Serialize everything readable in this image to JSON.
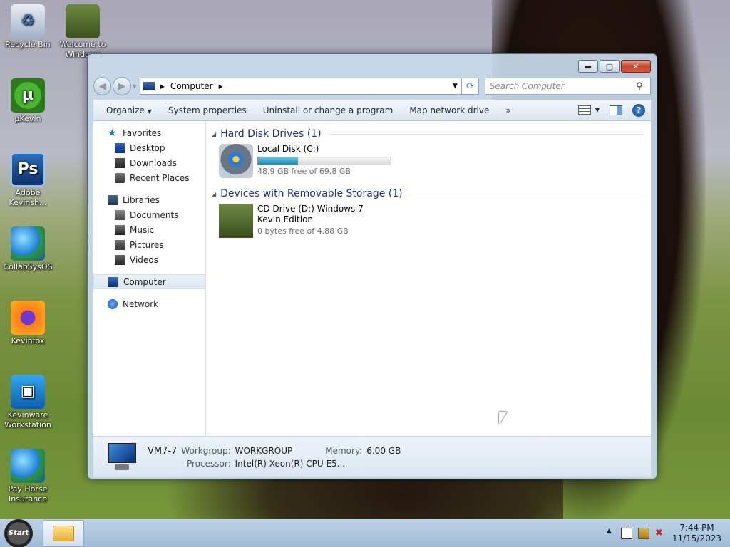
{
  "desktop": {
    "icons": [
      {
        "label": "Recycle Bin",
        "icon": "recycle-bin-icon"
      },
      {
        "label": "Welcome to Windows",
        "icon": "welcome-horse-icon"
      },
      {
        "label": "µKevin",
        "icon": "utorrent-icon"
      },
      {
        "label": "Adobe Kevinsh...",
        "icon": "photoshop-icon"
      },
      {
        "label": "CollabSysOS",
        "icon": "globe-icon"
      },
      {
        "label": "Kevinfox",
        "icon": "firefox-icon"
      },
      {
        "label": "Kevinware Workstation",
        "icon": "vmware-icon"
      },
      {
        "label": "Pay Horse Insurance",
        "icon": "globe-icon"
      }
    ]
  },
  "window": {
    "caption": {
      "minimize": "▬",
      "maximize": "▢",
      "close": "✕"
    },
    "address": {
      "root": "Computer"
    },
    "search": {
      "placeholder": "Search Computer"
    },
    "toolbar": {
      "organize": "Organize",
      "system_properties": "System properties",
      "uninstall": "Uninstall or change a program",
      "map_drive": "Map network drive",
      "more": "»"
    },
    "navpane": {
      "favorites": "Favorites",
      "desktop": "Desktop",
      "downloads": "Downloads",
      "recent_places": "Recent Places",
      "libraries": "Libraries",
      "documents": "Documents",
      "music": "Music",
      "pictures": "Pictures",
      "videos": "Videos",
      "computer": "Computer",
      "network": "Network"
    },
    "groups": {
      "hdd_title": "Hard Disk Drives (1)",
      "removable_title": "Devices with Removable Storage (1)"
    },
    "drives": {
      "local": {
        "name": "Local Disk (C:)",
        "free": "48.9 GB free of 69.8 GB",
        "used_fraction": 0.3
      },
      "cd": {
        "name": "CD Drive (D:) Windows 7 Kevin Edition",
        "free": "0 bytes free of 4.88 GB"
      }
    },
    "details": {
      "name": "VM7-7",
      "workgroup_label": "Workgroup:",
      "workgroup": "WORKGROUP",
      "memory_label": "Memory:",
      "memory": "6.00 GB",
      "processor_label": "Processor:",
      "processor": "Intel(R) Xeon(R) CPU E5..."
    }
  },
  "taskbar": {
    "start": "Start",
    "clock_time": "7:44 PM",
    "clock_date": "11/15/2023"
  }
}
